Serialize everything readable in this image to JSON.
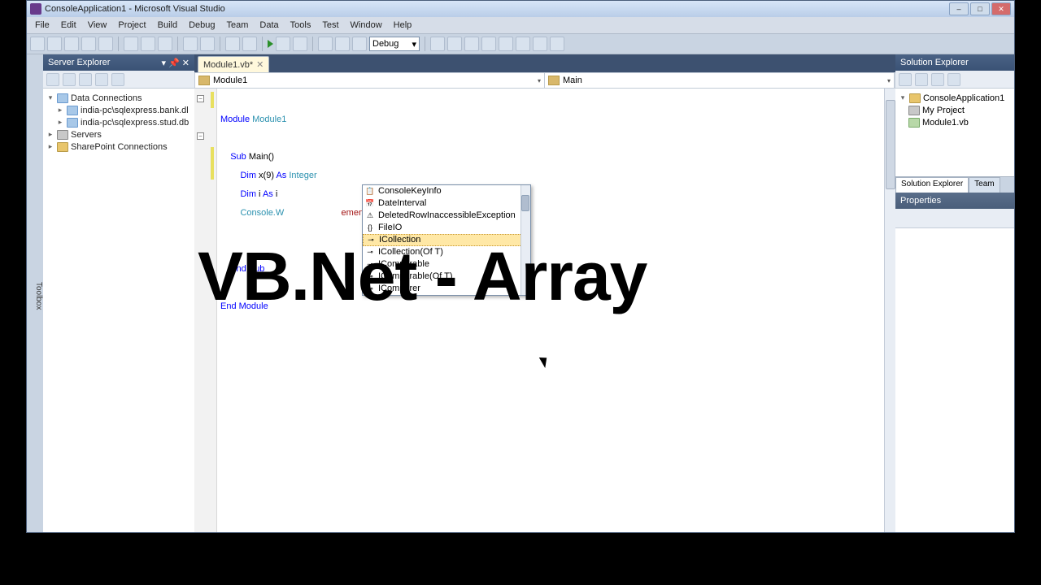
{
  "window": {
    "title": "ConsoleApplication1 - Microsoft Visual Studio"
  },
  "menu": {
    "file": "File",
    "edit": "Edit",
    "view": "View",
    "project": "Project",
    "build": "Build",
    "debug": "Debug",
    "team": "Team",
    "data": "Data",
    "tools": "Tools",
    "test": "Test",
    "window": "Window",
    "help": "Help"
  },
  "toolbar": {
    "config": "Debug"
  },
  "toolbox": {
    "label": "Toolbox"
  },
  "server_explorer": {
    "title": "Server Explorer",
    "items": [
      {
        "label": "Data Connections",
        "expanded": true
      },
      {
        "label": "india-pc\\sqlexpress.bank.dl"
      },
      {
        "label": "india-pc\\sqlexpress.stud.db"
      },
      {
        "label": "Servers"
      },
      {
        "label": "SharePoint Connections"
      }
    ]
  },
  "doc_tab": {
    "label": "Module1.vb*"
  },
  "nav": {
    "left": "Module1",
    "right": "Main"
  },
  "code": {
    "l1a": "Module",
    "l1b": " Module1",
    "l2a": "    Sub",
    "l2b": " Main()",
    "l3a": "        Dim",
    "l3b": " x(9) ",
    "l3c": "As ",
    "l3d": "Integer",
    "l4a": "        Dim",
    "l4b": " i ",
    "l4c": "As",
    "l4d": " i",
    "l5a": "        Console.W",
    "l5b": "ements of an array\"",
    ")": ")",
    "l6": "    End Sub",
    "l7": "End Module"
  },
  "intellisense": {
    "items": [
      {
        "icon": "📋",
        "label": "ConsoleKeyInfo"
      },
      {
        "icon": "📅",
        "label": "DateInterval"
      },
      {
        "icon": "⚠",
        "label": "DeletedRowInaccessibleException"
      },
      {
        "icon": "{}",
        "label": "FileIO"
      },
      {
        "icon": "⊸",
        "label": "ICollection",
        "selected": true
      },
      {
        "icon": "⊸",
        "label": "ICollection(Of T)"
      },
      {
        "icon": "⊸",
        "label": "IComparable"
      },
      {
        "icon": "⊸",
        "label": "IComparable(Of T)"
      },
      {
        "icon": "⊸",
        "label": "IComparer"
      }
    ]
  },
  "solution": {
    "title": "Solution Explorer",
    "items": [
      {
        "label": "ConsoleApplication1"
      },
      {
        "label": "My Project"
      },
      {
        "label": "Module1.vb"
      }
    ],
    "tab1": "Solution Explorer",
    "tab2": "Team"
  },
  "properties": {
    "title": "Properties"
  },
  "overlay": "VB.Net - Array"
}
